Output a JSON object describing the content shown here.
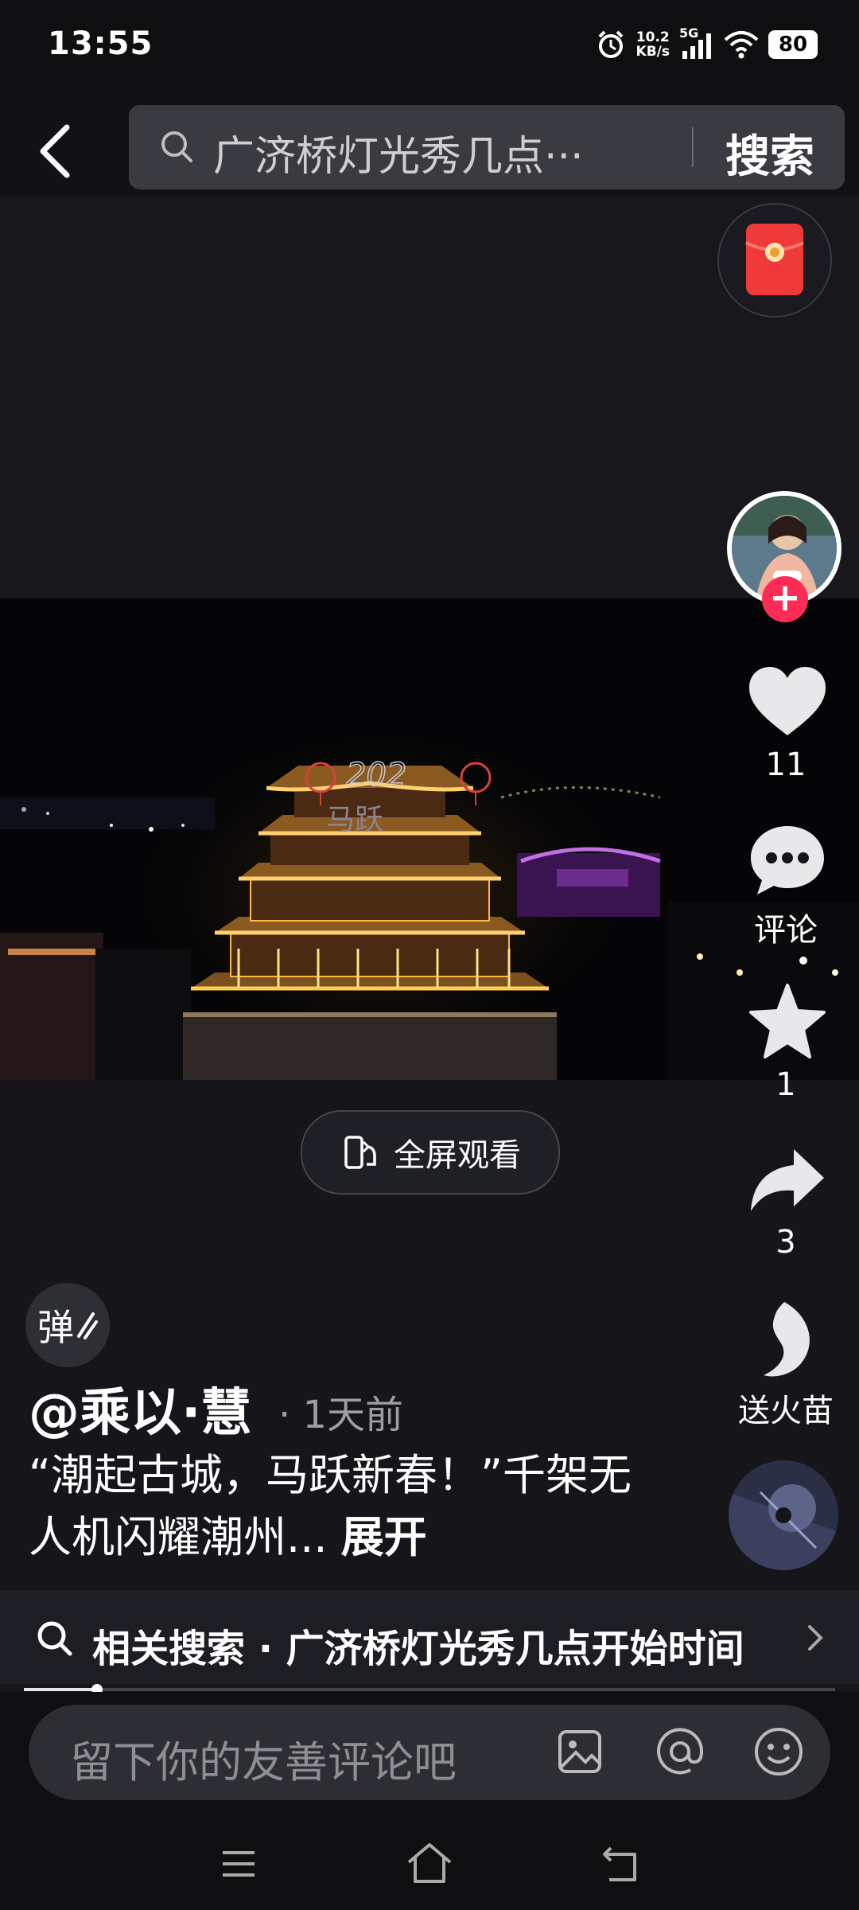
{
  "status_bar": {
    "time": "13:55",
    "net_speed_value": "10.2",
    "net_speed_unit": "KB/s",
    "network": "5G",
    "battery": "80"
  },
  "header": {
    "search_query": "广济桥灯光秀几点···",
    "search_button": "搜索"
  },
  "rail": {
    "likes": "11",
    "comment_label": "评论",
    "favorites": "1",
    "shares": "3",
    "gift_label": "送火苗"
  },
  "video": {
    "fullscreen_label": "全屏观看",
    "danmu_label": "弹",
    "overlay_text_top": "202",
    "overlay_text_bottom": "马跃"
  },
  "post": {
    "author": "@乘以·慧",
    "time_ago": "· 1天前",
    "description": "“潮起古城，马跃新春！”千架无人机闪耀潮州...",
    "expand": "展开"
  },
  "related": {
    "text": "相关搜索 · 广济桥灯光秀几点开始时间"
  },
  "playback": {
    "progress": 0.09
  },
  "comment": {
    "placeholder": "留下你的友善评论吧"
  },
  "colors": {
    "accent_red": "#fe2c55",
    "background": "#15151a"
  }
}
